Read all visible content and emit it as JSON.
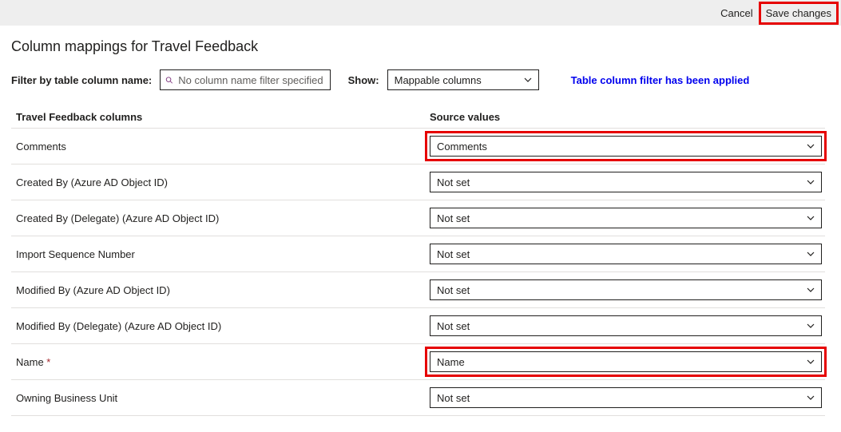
{
  "topbar": {
    "cancel": "Cancel",
    "save": "Save changes"
  },
  "page_title": "Column mappings for Travel Feedback",
  "filter": {
    "label": "Filter by table column name:",
    "placeholder": "No column name filter specified"
  },
  "show": {
    "label": "Show:",
    "value": "Mappable columns"
  },
  "filter_applied_msg": "Table column filter has been applied",
  "headers": {
    "left": "Travel Feedback columns",
    "right": "Source values"
  },
  "rows": [
    {
      "label": "Comments",
      "value": "Comments",
      "required": false,
      "highlight": true
    },
    {
      "label": "Created By (Azure AD Object ID)",
      "value": "Not set",
      "required": false,
      "highlight": false
    },
    {
      "label": "Created By (Delegate) (Azure AD Object ID)",
      "value": "Not set",
      "required": false,
      "highlight": false
    },
    {
      "label": "Import Sequence Number",
      "value": "Not set",
      "required": false,
      "highlight": false
    },
    {
      "label": "Modified By (Azure AD Object ID)",
      "value": "Not set",
      "required": false,
      "highlight": false
    },
    {
      "label": "Modified By (Delegate) (Azure AD Object ID)",
      "value": "Not set",
      "required": false,
      "highlight": false
    },
    {
      "label": "Name",
      "value": "Name",
      "required": true,
      "highlight": true
    },
    {
      "label": "Owning Business Unit",
      "value": "Not set",
      "required": false,
      "highlight": false
    }
  ]
}
